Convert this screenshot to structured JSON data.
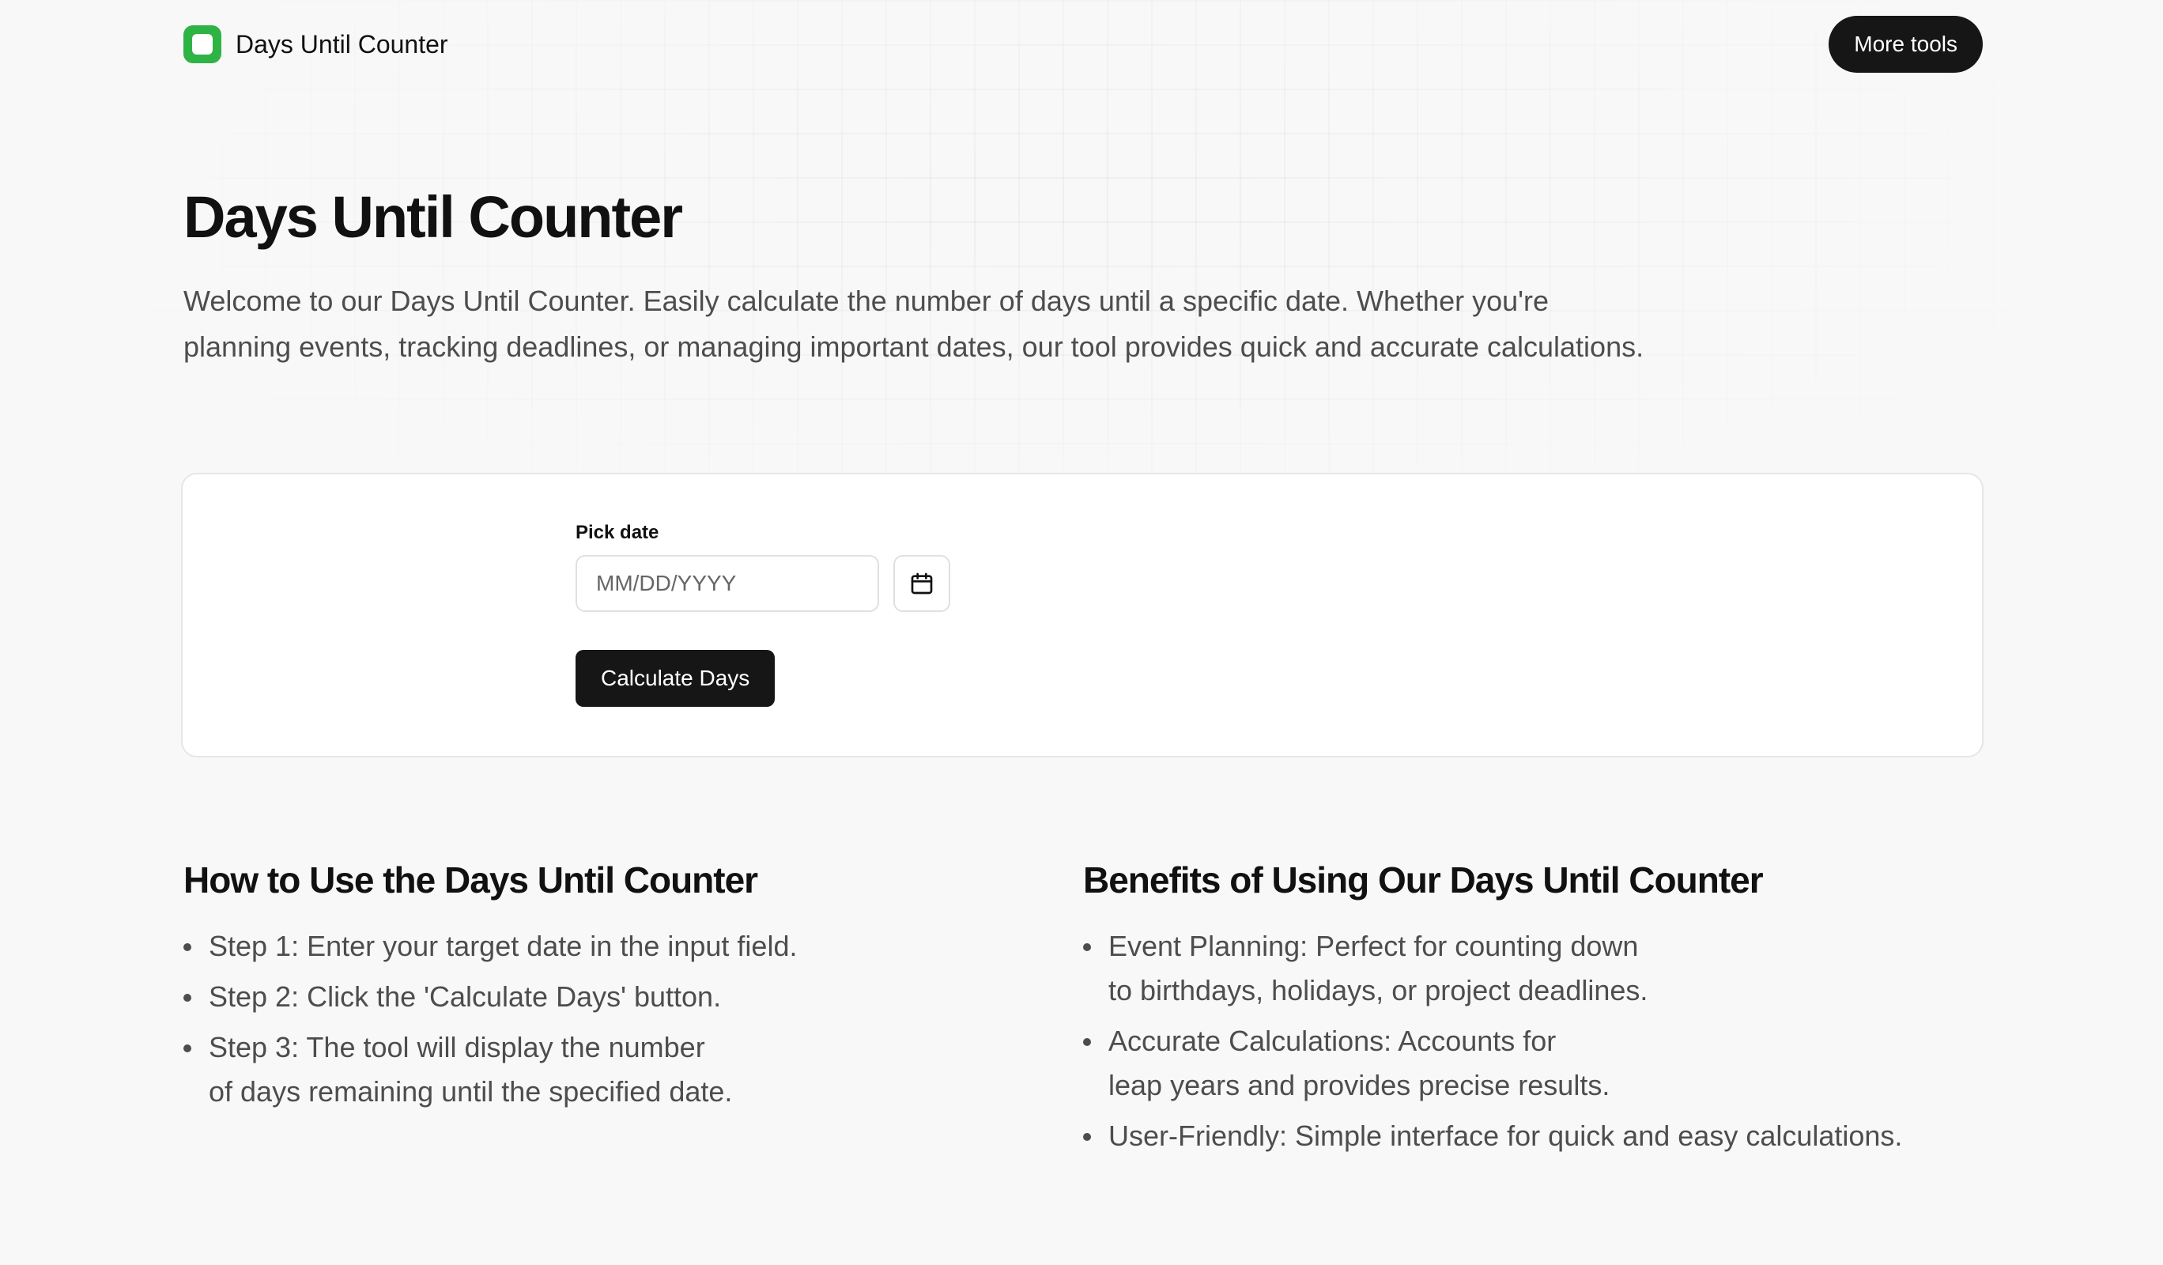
{
  "header": {
    "brand_name": "Days Until Counter",
    "more_tools_label": "More tools"
  },
  "hero": {
    "title": "Days Until Counter",
    "intro_line_1": "Welcome to our Days Until Counter. Easily calculate the number of days until a specific date. Whether you're",
    "intro_line_2": "planning events, tracking deadlines, or managing important dates, our tool provides quick and accurate calculations."
  },
  "form": {
    "date_label": "Pick date",
    "date_placeholder": "MM/DD/YYYY",
    "date_value": "",
    "calendar_icon": "calendar-icon",
    "calculate_label": "Calculate Days"
  },
  "how_to": {
    "title": "How to Use the Days Until Counter",
    "steps": [
      {
        "lines": [
          "Step 1: Enter your target date in the input field."
        ]
      },
      {
        "lines": [
          "Step 2: Click the 'Calculate Days' button."
        ]
      },
      {
        "lines": [
          "Step 3: The tool will display the number",
          "of days remaining until the specified date."
        ]
      }
    ]
  },
  "benefits": {
    "title": "Benefits of Using Our Days Until Counter",
    "items": [
      {
        "lines": [
          "Event Planning: Perfect for counting down",
          "to birthdays, holidays, or project deadlines."
        ]
      },
      {
        "lines": [
          "Accurate Calculations: Accounts for",
          "leap years and provides precise results."
        ]
      },
      {
        "lines": [
          "User-Friendly: Simple interface for quick and easy calculations."
        ]
      }
    ]
  },
  "colors": {
    "brand_green": "#2fb344",
    "button_dark": "#161616",
    "background": "#f8f8f8",
    "body_text": "#4d4d4d"
  }
}
